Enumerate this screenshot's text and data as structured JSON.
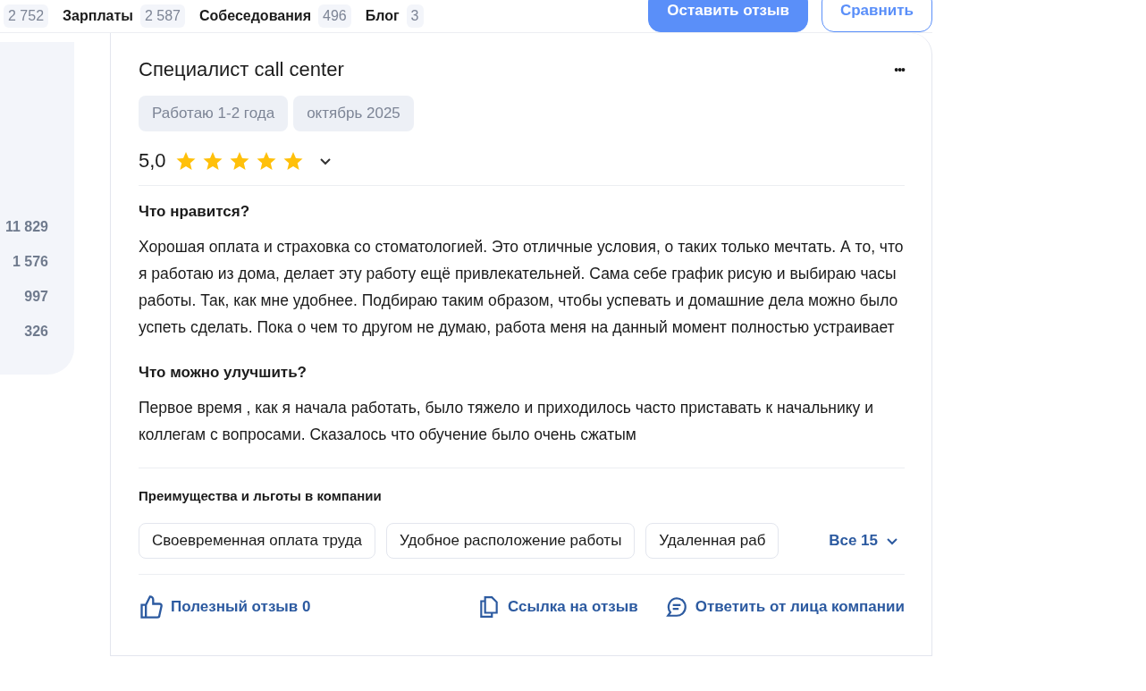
{
  "nav": [
    {
      "count": "2 752"
    },
    {
      "label": "Зарплаты",
      "count": "2 587"
    },
    {
      "label": "Собеседования",
      "count": "496"
    },
    {
      "label": "Блог",
      "count": "3"
    }
  ],
  "actions": {
    "primary": "Оставить отзыв",
    "secondary": "Сравнить"
  },
  "sidebar_counts": [
    "11 829",
    "1 576",
    "997",
    "326"
  ],
  "review": {
    "title": "Специалист call center",
    "more": "•••",
    "tags": [
      "Работаю 1-2 года",
      "октябрь 2025"
    ],
    "rating": "5,0",
    "stars": 5,
    "sections": [
      {
        "heading": "Что нравится?",
        "text": "Хорошая оплата и страховка со стоматологией. Это отличные условия, о таких только мечтать. А то, что я работаю из дома, делает эту работу ещё привлекательней. Сама себе график рисую и выбираю часы работы. Так, как мне удобнее. Подбираю таким образом, чтобы успевать и домашние дела можно было успеть сделать. Пока о чем то другом не думаю, работа меня на данный момент полностью устраивает"
      },
      {
        "heading": "Что можно улучшить?",
        "text": "Первое время , как я начала работать, было тяжело и приходилось часто приставать к начальнику и коллегам с вопросами. Сказалось что обучение было очень сжатым"
      }
    ],
    "benefits_title": "Преимущества и льготы в компании",
    "benefits": [
      "Своевременная оплата труда",
      "Удобное расположение работы",
      "Удаленная раб"
    ],
    "benefits_all": "Все 15",
    "footer": {
      "useful": "Полезный отзыв 0",
      "link": "Ссылка на отзыв",
      "reply": "Ответить от лица компании"
    }
  }
}
